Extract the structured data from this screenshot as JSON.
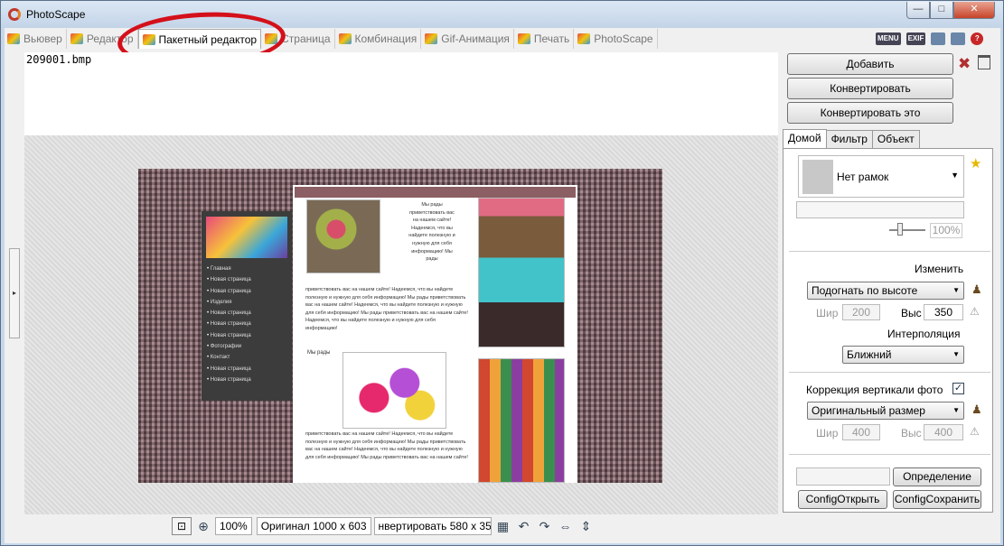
{
  "window": {
    "title": "PhotoScape",
    "min_glyph": "—",
    "max_glyph": "□",
    "close_glyph": "✕"
  },
  "tabs": [
    {
      "label": "Вьювер",
      "icon": "viewer-icon"
    },
    {
      "label": "Редактор",
      "icon": "editor-icon"
    },
    {
      "label": "Пакетный редактор",
      "icon": "batch-editor-icon",
      "active": true
    },
    {
      "label": "Страница",
      "icon": "page-icon"
    },
    {
      "label": "Комбинация",
      "icon": "combine-icon"
    },
    {
      "label": "Gif-Анимация",
      "icon": "gif-icon"
    },
    {
      "label": "Печать",
      "icon": "print-icon"
    },
    {
      "label": "PhotoScape",
      "icon": "photoscape-icon"
    }
  ],
  "toolbar_right": {
    "menu": "MENU",
    "exif": "EXIF",
    "help": "?"
  },
  "filelist": {
    "items": [
      "209001.bmp"
    ]
  },
  "preview": {
    "nav_items": [
      "Главная",
      "Новая страница",
      "Новая страница",
      "Изделия",
      "Новая страница",
      "Новая страница",
      "Новая страница",
      "Фотографии",
      "Контакт",
      "Новая страница",
      "Новая страница"
    ],
    "text_top": "Мы рады приветствовать вас на нашем сайте! Надеемся, что вы найдете полезную и нужную для себя информацию! Мы рады",
    "text_mid": "приветствовать вас на нашем сайте! Надеемся, что вы найдете полезную и нужную для себя информацию! Мы рады приветствовать вас на нашем сайте! Надеемся, что вы найдете полезную и нужную для себя информацию! Мы рады приветствовать вас на нашем сайте! Надеемся, что вы найдете полезную и нужную для себя информацию!",
    "caption": "Мы рады",
    "text_bottom": "приветствовать вас на нашем сайте! Надеемся, что вы найдете полезную и нужную для себя информацию! Мы рады приветствовать вас на нашем сайте! Надеемся, что вы найдете полезную и нужную для себя информацию! Мы рады приветствовать вас на нашем сайте!"
  },
  "statusbar": {
    "zoom": "100%",
    "original": "Оригинал 1000 x 603",
    "convert": "нвертировать 580 x 35"
  },
  "right_panel": {
    "add_button": "Добавить",
    "convert_button": "Конвертировать",
    "convert_this_button": "Конвертировать это",
    "tabs": [
      "Домой",
      "Фильтр",
      "Объект"
    ],
    "frame": "Нет рамок",
    "frame_percent": "100%",
    "resize_label": "Изменить",
    "resize_mode": "Подогнать по высоте",
    "width_label": "Шир",
    "width_value": "200",
    "height_label": "Выс",
    "height_value": "350",
    "interp_label": "Интерполяция",
    "interp_value": "Ближний",
    "vertical_label": "Коррекция вертикали фото",
    "vertical_checked": "✓",
    "vertical_mode": "Оригинальный размер",
    "v_width_label": "Шир",
    "v_width_value": "400",
    "v_height_label": "Выс",
    "v_height_value": "400",
    "define_button": "Определение",
    "config_open": "ConfigОткрыть",
    "config_save": "ConfigСохранить"
  }
}
